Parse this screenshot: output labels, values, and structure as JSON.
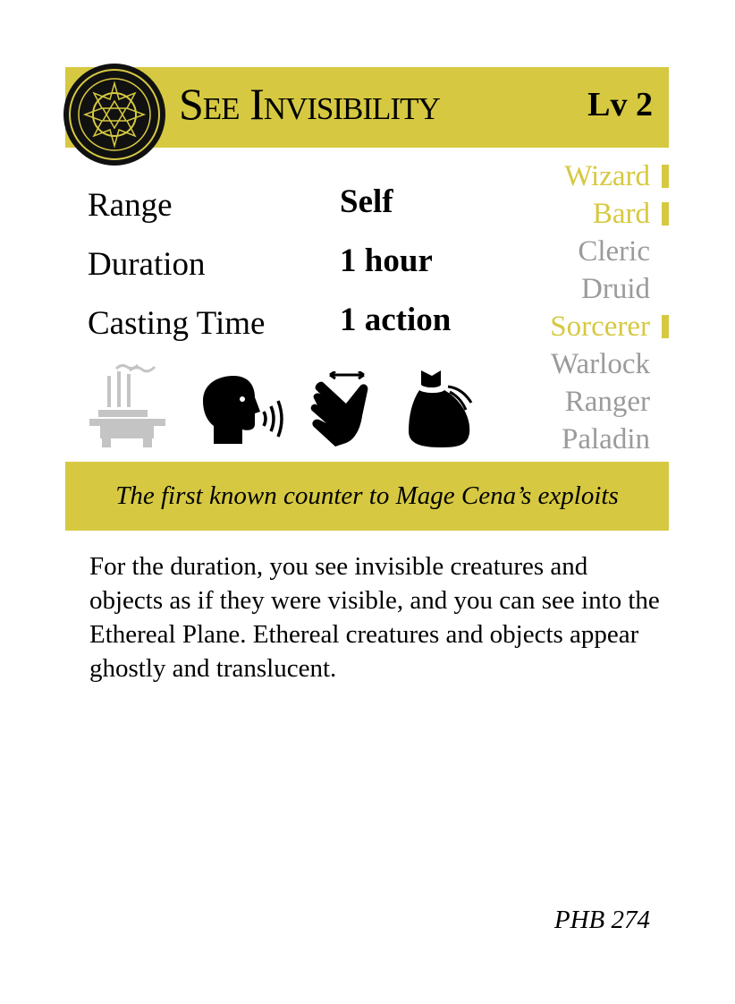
{
  "card": {
    "title": "See Invisibility",
    "level": "Lv 2",
    "accent_color": "#d6c941",
    "inactive_color": "#9b9b9b",
    "emblem_icon": "magic-circle-icon",
    "stats": [
      {
        "label": "Range",
        "value": "Self"
      },
      {
        "label": "Duration",
        "value": "1 hour"
      },
      {
        "label": "Casting Time",
        "value": "1 action"
      }
    ],
    "classes": [
      {
        "name": "Wizard",
        "available": true
      },
      {
        "name": "Bard",
        "available": true
      },
      {
        "name": "Cleric",
        "available": false
      },
      {
        "name": "Druid",
        "available": false
      },
      {
        "name": "Sorcerer",
        "available": true
      },
      {
        "name": "Warlock",
        "available": false
      },
      {
        "name": "Ranger",
        "available": false
      },
      {
        "name": "Paladin",
        "available": false
      }
    ],
    "components": [
      {
        "icon": "ritual-brazier-icon",
        "active": false
      },
      {
        "icon": "verbal-speaking-head-icon",
        "active": true
      },
      {
        "icon": "somatic-hand-icon",
        "active": true
      },
      {
        "icon": "material-pouch-icon",
        "active": true
      }
    ],
    "flavor": "The first known counter to Mage Cena’s exploits",
    "description": "For the duration, you see invisible creatures and objects as if they were visible, and you can see into the Ethereal Plane. Ethereal creatures and objects appear ghostly and translucent.",
    "source": "PHB 274"
  }
}
